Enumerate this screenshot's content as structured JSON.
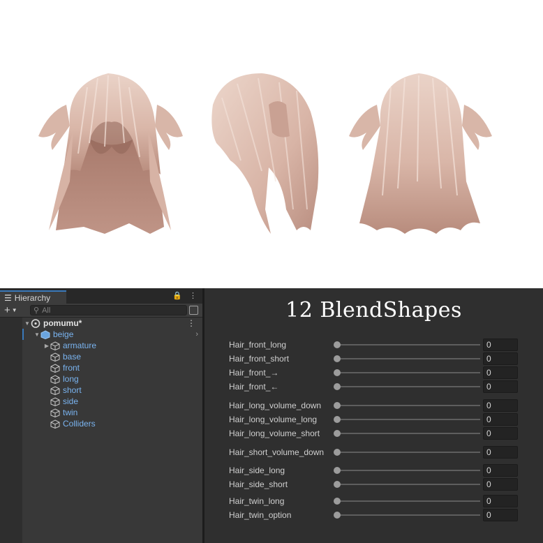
{
  "hierarchy": {
    "tab_label": "Hierarchy",
    "search_placeholder": "All",
    "scene_name": "pomumu*",
    "root_object": "beige",
    "children": [
      "armature",
      "base",
      "front",
      "long",
      "short",
      "side",
      "twin",
      "Colliders"
    ]
  },
  "blendshapes": {
    "title": "12 BlendShapes",
    "items": [
      {
        "label": "Hair_front_long",
        "value": "0"
      },
      {
        "label": "Hair_front_short",
        "value": "0"
      },
      {
        "label": "Hair_front_→",
        "value": "0"
      },
      {
        "label": "Hair_front_←",
        "value": "0"
      },
      {
        "label": "Hair_long_volume_down",
        "value": "0"
      },
      {
        "label": "Hair_long_volume_long",
        "value": "0"
      },
      {
        "label": "Hair_long_volume_short",
        "value": "0"
      },
      {
        "label": "Hair_short_volume_down",
        "value": "0"
      },
      {
        "label": "Hair_side_long",
        "value": "0"
      },
      {
        "label": "Hair_side_short",
        "value": "0"
      },
      {
        "label": "Hair_twin_long",
        "value": "0"
      },
      {
        "label": "Hair_twin_option",
        "value": "0"
      }
    ]
  },
  "colors": {
    "hair_light": "#e8cfc4",
    "hair_mid": "#d2aea0",
    "hair_dark": "#a97c6e",
    "accent_blue": "#3a79bb",
    "object_label": "#7ab4f0"
  }
}
